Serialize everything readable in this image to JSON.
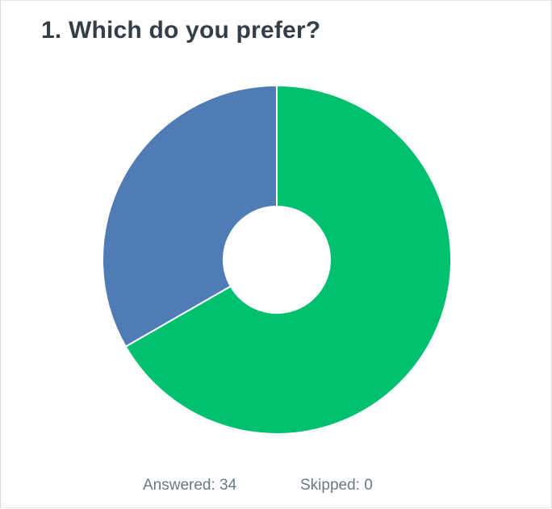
{
  "question": {
    "title": "1. Which do you prefer?"
  },
  "footer": {
    "answered_label": "Answered: 34",
    "skipped_label": "Skipped: 0"
  },
  "colors": {
    "green": "#00bf6f",
    "blue": "#507cb6",
    "title": "#333e48",
    "stats": "#6b787f"
  },
  "chart_data": {
    "type": "pie",
    "donut": true,
    "title": "1. Which do you prefer?",
    "legend": "none",
    "slices": [
      {
        "value": 66.7,
        "color": "#00bf6f"
      },
      {
        "value": 33.3,
        "color": "#507cb6"
      }
    ]
  }
}
